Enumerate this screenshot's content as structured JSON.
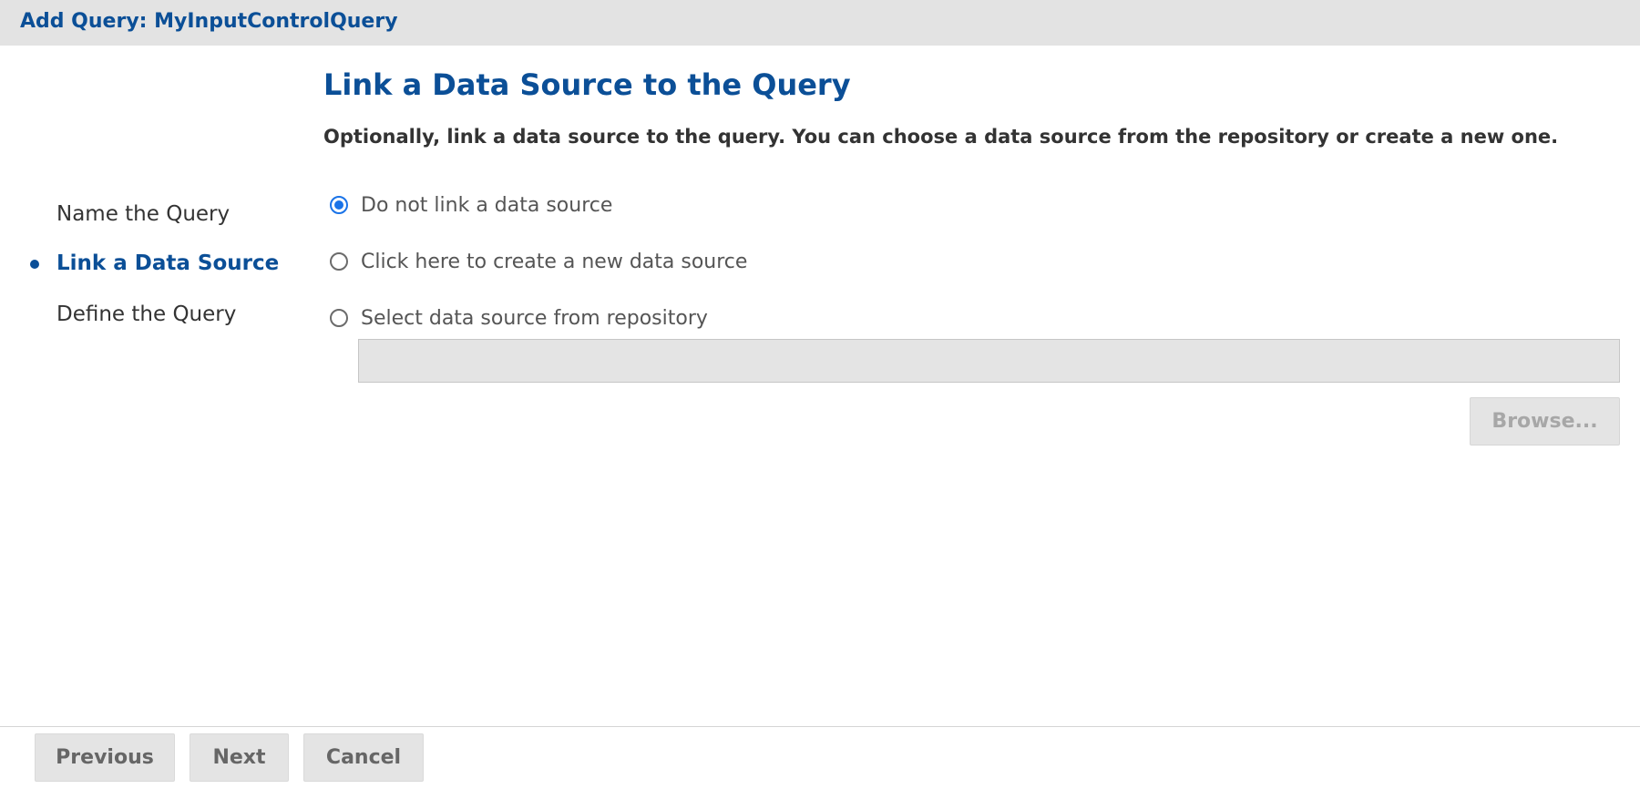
{
  "window": {
    "title": "Add Query: MyInputControlQuery"
  },
  "steps": {
    "items": [
      {
        "label": "Name the Query",
        "active": false
      },
      {
        "label": "Link a Data Source",
        "active": true
      },
      {
        "label": "Define the Query",
        "active": false
      }
    ]
  },
  "main": {
    "heading": "Link a Data Source to the Query",
    "description": "Optionally, link a data source to the query. You can choose a data source from the repository or create a new one.",
    "options": [
      {
        "label": "Do not link a data source",
        "checked": true
      },
      {
        "label": "Click here to create a new data source",
        "checked": false
      },
      {
        "label": "Select data source from repository",
        "checked": false
      }
    ],
    "repository_path": {
      "value": ""
    },
    "browse_label": "Browse..."
  },
  "footer": {
    "previous_label": "Previous",
    "next_label": "Next",
    "cancel_label": "Cancel"
  },
  "colors": {
    "accent": "#0b4f97",
    "radio_checked": "#1a73e8",
    "titlebar_bg": "#e3e3e3",
    "button_bg": "#e4e4e4"
  }
}
